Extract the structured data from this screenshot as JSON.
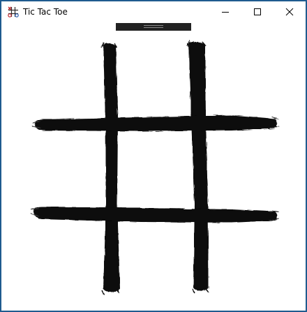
{
  "window": {
    "title": "Tic Tac Toe",
    "app_icon": "tic-tac-toe-icon",
    "controls": [
      "minimize-icon",
      "maximize-icon",
      "close-icon"
    ]
  },
  "toolbar": {
    "grip_icon": "drag-grip-icon"
  },
  "board": {
    "grid_color": "#000000",
    "background": "#ffffff",
    "cells": [
      [
        "",
        "",
        ""
      ],
      [
        "",
        "",
        ""
      ],
      [
        "",
        "",
        ""
      ]
    ]
  }
}
